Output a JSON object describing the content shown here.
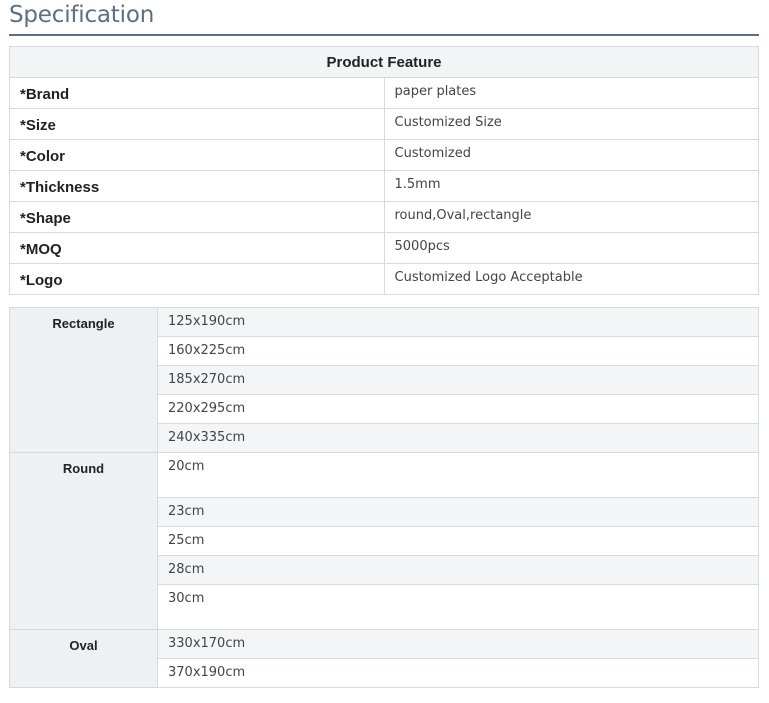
{
  "page": {
    "title": "Specification"
  },
  "feature_table": {
    "header": "Product Feature",
    "rows": [
      {
        "key": "*Brand",
        "value": "paper plates"
      },
      {
        "key": "*Size",
        "value": "Customized Size"
      },
      {
        "key": "*Color",
        "value": "Customized"
      },
      {
        "key": "*Thickness",
        "value": "1.5mm"
      },
      {
        "key": "*Shape",
        "value": "round,Oval,rectangle"
      },
      {
        "key": "*MOQ",
        "value": "5000pcs"
      },
      {
        "key": "*Logo",
        "value": "Customized Logo Acceptable"
      }
    ]
  },
  "size_table": {
    "groups": [
      {
        "name": "Rectangle",
        "values": [
          "125x190cm",
          "160x225cm",
          "185x270cm",
          "220x295cm",
          "240x335cm"
        ]
      },
      {
        "name": "Round",
        "values": [
          "20cm",
          "23cm",
          "25cm",
          "28cm",
          "30cm"
        ]
      },
      {
        "name": "Oval",
        "values": [
          "330x170cm",
          "370x190cm"
        ]
      }
    ]
  },
  "colors": {
    "title": "#5c6f86",
    "border": "#d6d9dd",
    "header_bg": "#f3f4f6",
    "group_bg": "#eef0f3",
    "alt_row_bg": "#f4f5f7"
  }
}
